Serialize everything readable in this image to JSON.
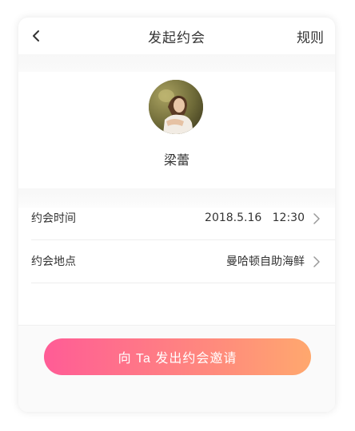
{
  "colors": {
    "cta_gradient_start": "#ff5c96",
    "cta_gradient_end": "#ffa86e",
    "text": "#333333",
    "divider": "#eeeeee",
    "section_background": "#f7f7f7"
  },
  "nav": {
    "back_icon": "chevron-left-icon",
    "title": "发起约会",
    "rules": "规则"
  },
  "profile": {
    "avatar_icon": "user-photo",
    "name": "梁蕾"
  },
  "details": [
    {
      "label": "约会时间",
      "value": "2018.5.16   12:30",
      "icon": "chevron-right-icon"
    },
    {
      "label": "约会地点",
      "value": "曼哈顿自助海鲜",
      "icon": "chevron-right-icon"
    }
  ],
  "cta": {
    "label": "向 Ta 发出约会邀请"
  }
}
